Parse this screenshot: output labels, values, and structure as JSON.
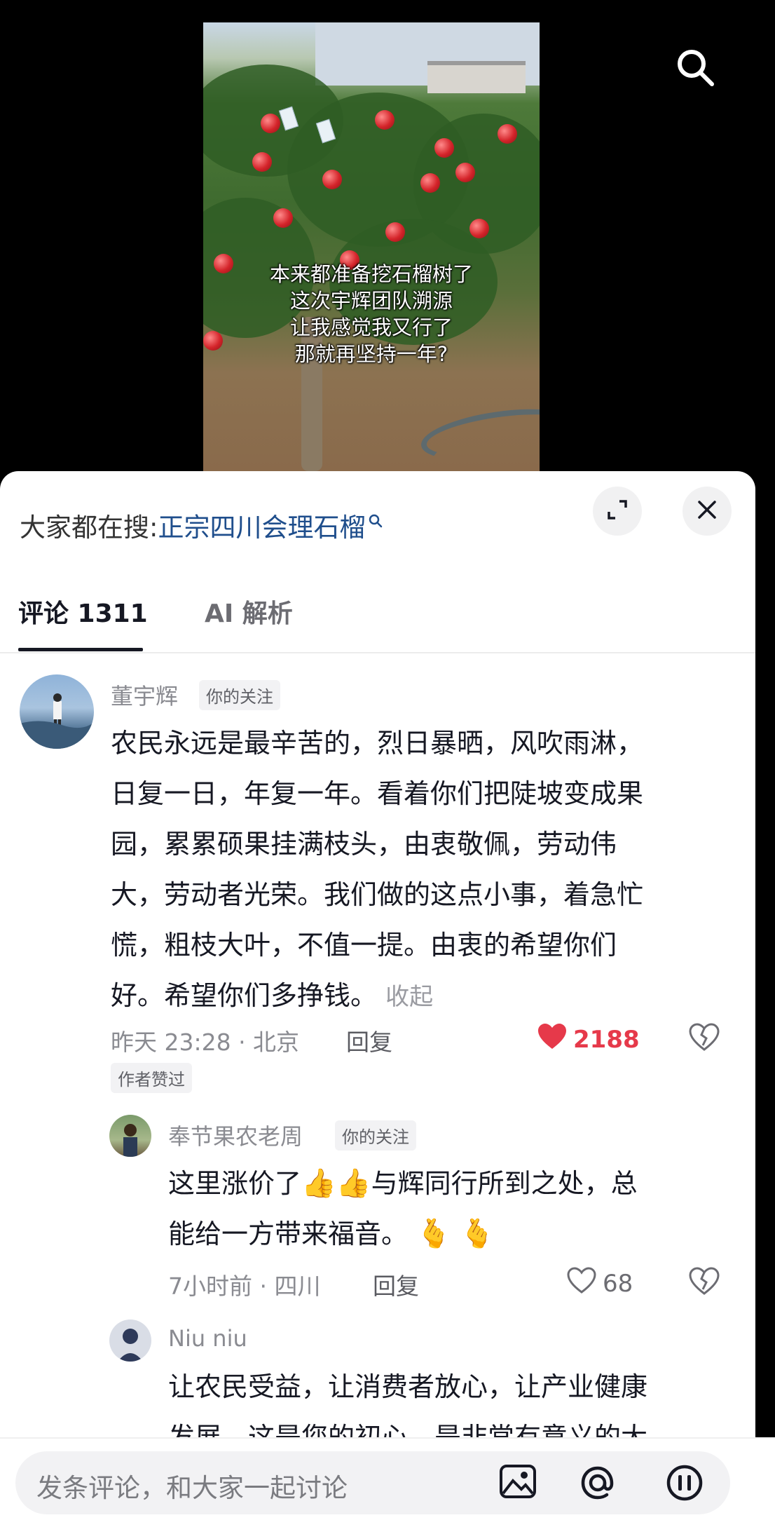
{
  "video": {
    "subtitle_lines": [
      "本来都准备挖石榴树了",
      "这次宇辉团队溯源",
      "让我感觉我又行了",
      "那就再坚持一年?"
    ]
  },
  "header": {
    "search_prefix": "大家都在搜:",
    "search_keyword": "正宗四川会理石榴"
  },
  "tabs": [
    {
      "label": "评论 1311",
      "active": true
    },
    {
      "label": "AI 解析",
      "active": false
    }
  ],
  "comments": [
    {
      "user": "董宇辉",
      "badge": "你的关注",
      "lines": [
        "农民永远是最辛苦的，烈日暴晒，风吹雨淋，",
        "日复一日，年复一年。看着你们把陡坡变成果",
        "园，累累硕果挂满枝头，由衷敬佩，劳动伟",
        "大，劳动者光荣。我们做的这点小事，着急忙",
        "慌，粗枝大叶，不值一提。由衷的希望你们",
        "好。希望你们多挣钱。"
      ],
      "collapse": "收起",
      "time_location": "昨天 23:28 · 北京",
      "reply": "回复",
      "likes": "2188",
      "author_liked": "作者赞过"
    },
    {
      "user": "奉节果农老周",
      "badge": "你的关注",
      "line1_a": "这里涨价了",
      "line1_b": "与辉同行所到之处，总",
      "line2": "能给一方带来福音。",
      "time_location": "7小时前 · 四川",
      "reply": "回复",
      "likes": "68"
    },
    {
      "user": "Niu niu",
      "lines": [
        "让农民受益，让消费者放心，让产业健康",
        "发展，这是您的初心，是非常有意义的大"
      ]
    }
  ],
  "bottom": {
    "placeholder": "发条评论，和大家一起讨论"
  },
  "colors": {
    "like_active": "#e6394a",
    "keyword_link": "#1f4e8c"
  }
}
